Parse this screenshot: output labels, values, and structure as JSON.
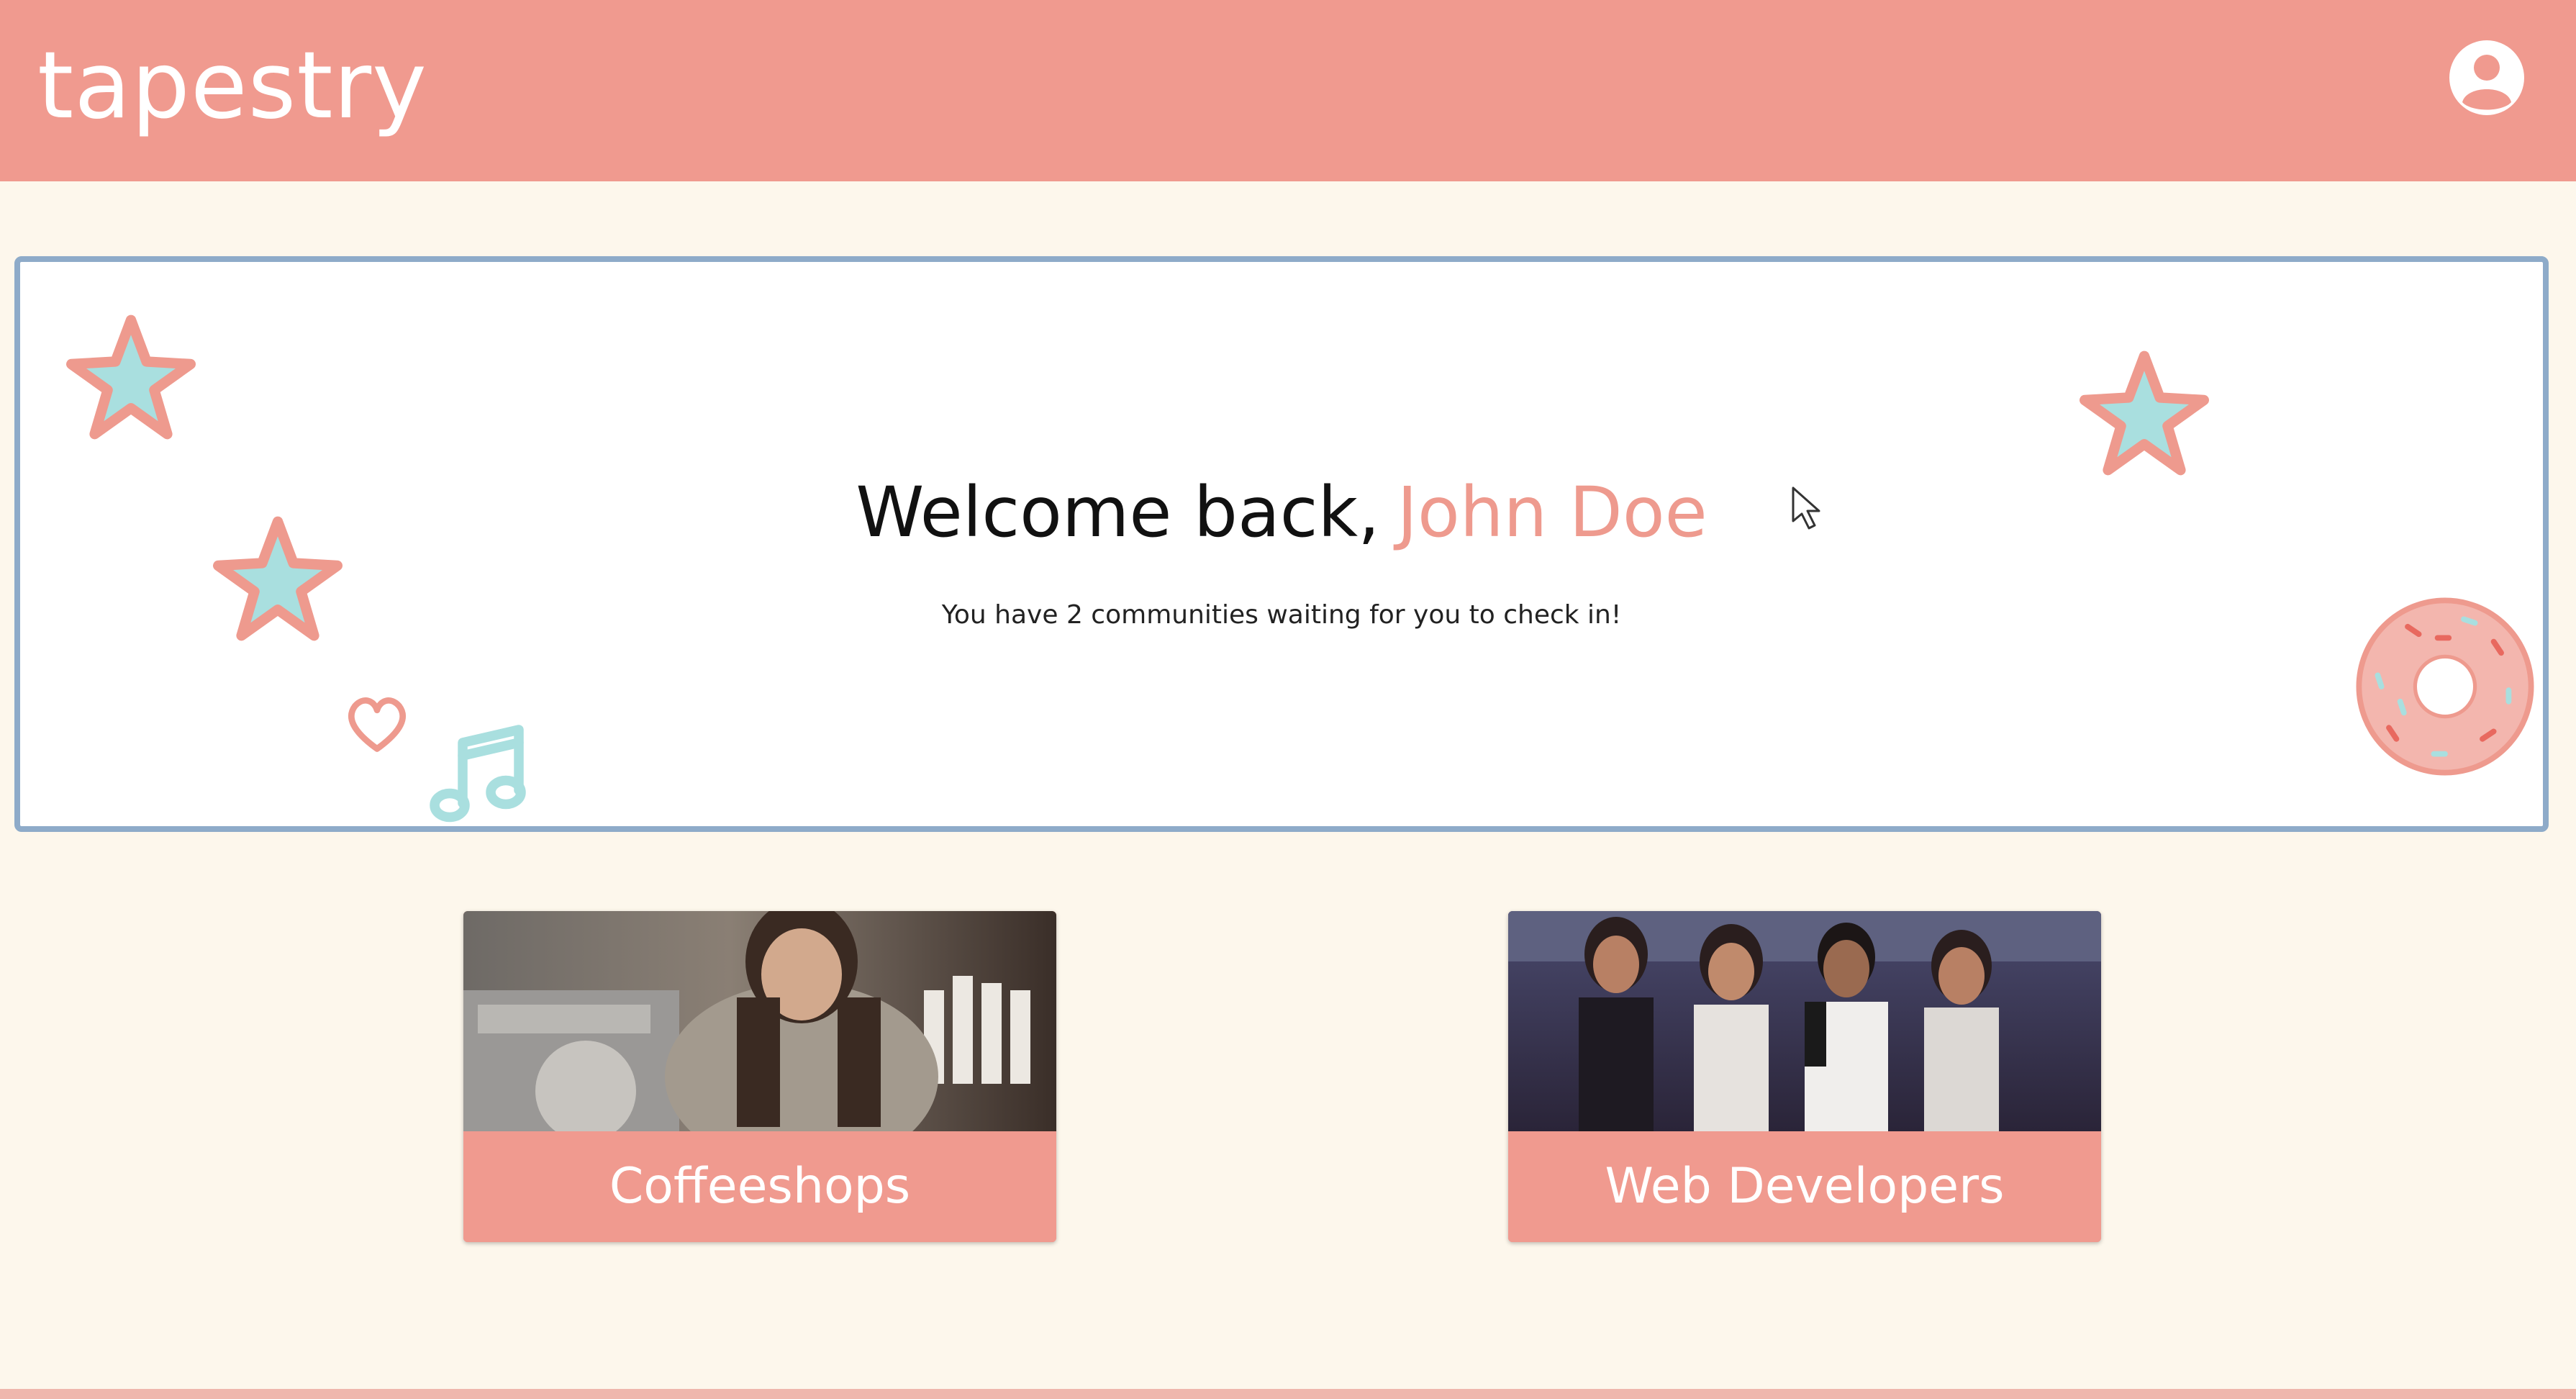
{
  "header": {
    "logo": "tapestry",
    "profile_icon": "user-circle-icon"
  },
  "welcome": {
    "greeting": "Welcome back,",
    "user_name": "John Doe",
    "subtitle": "You have 2 communities waiting for you to check in!"
  },
  "communities": [
    {
      "label": "Coffeeshops",
      "image": "barista-photo"
    },
    {
      "label": "Web Developers",
      "image": "group-photo"
    }
  ],
  "colors": {
    "header": "#f09a8f",
    "background": "#fdf7ec",
    "panel_border": "#8eabc9",
    "accent_name": "#ee9a8e",
    "star_fill": "#a9dfdf"
  }
}
